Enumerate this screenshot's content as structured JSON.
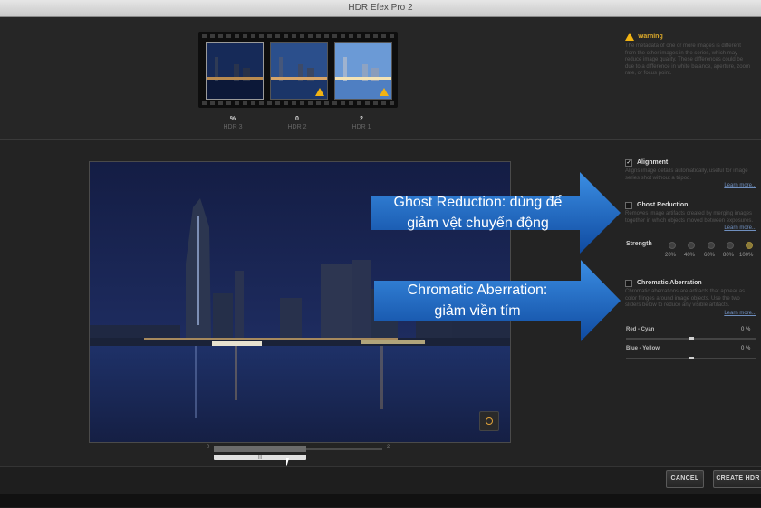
{
  "window": {
    "title": "HDR Efex Pro 2"
  },
  "exposures": [
    {
      "ev": "%",
      "name": "HDR 3",
      "warning": false
    },
    {
      "ev": "0",
      "name": "HDR 2",
      "warning": true
    },
    {
      "ev": "2",
      "name": "HDR 1",
      "warning": true
    }
  ],
  "warning": {
    "title": "Warning",
    "text": "The metadata of one or more images is different from the other images in the series, which may reduce image quality. These differences could be due to a difference in white balance, aperture, zoom rate, or focus point."
  },
  "alignment": {
    "label": "Alignment",
    "checked": true,
    "desc": "Aligns image details automatically, useful for image series shot without a tripod.",
    "learn": "Learn more..."
  },
  "ghost": {
    "label": "Ghost Reduction",
    "checked": false,
    "desc": "Removes image artifacts created by merging images together in which objects moved between exposures.",
    "learn": "Learn more..."
  },
  "strength": {
    "label": "Strength",
    "options": [
      "20%",
      "40%",
      "60%",
      "80%",
      "100%"
    ],
    "selected": "100%"
  },
  "chromatic": {
    "label": "Chromatic Aberration",
    "checked": false,
    "desc": "Chromatic aberrations are artifacts that appear as color fringes around image objects. Use the two sliders below to reduce any visible artifacts.",
    "learn": "Learn more...",
    "red_cyan": {
      "label": "Red - Cyan",
      "value": "0 %",
      "level": 0.5
    },
    "blue_yellow": {
      "label": "Blue - Yellow",
      "value": "0 %",
      "level": 0.5
    }
  },
  "callouts": {
    "ghost_line1": "Ghost Reduction: dùng để",
    "ghost_line2": "giảm vệt chuyển động",
    "chroma_line1": "Chromatic Aberration:",
    "chroma_line2": "giảm viền tím"
  },
  "timeline": {
    "start": "0",
    "end": "2",
    "handle": "|||"
  },
  "buttons": {
    "cancel": "CANCEL",
    "create": "CREATE HDR"
  },
  "colors": {
    "accent_blue": "#1d63b8",
    "warning": "#f2b312"
  }
}
